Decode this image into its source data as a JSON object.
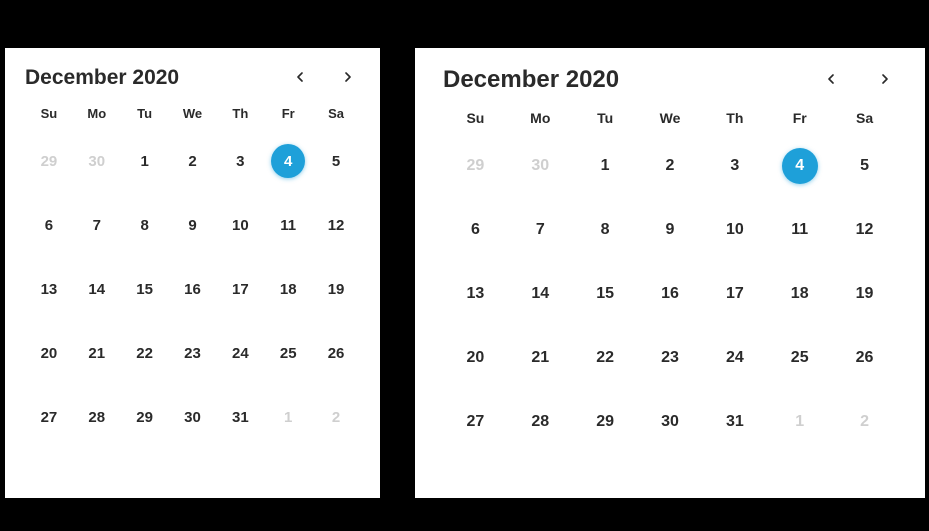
{
  "calendars": [
    {
      "size": "small",
      "title": "December 2020",
      "dow": [
        "Su",
        "Mo",
        "Tu",
        "We",
        "Th",
        "Fr",
        "Sa"
      ],
      "weeks": [
        [
          {
            "d": "29",
            "other": true
          },
          {
            "d": "30",
            "other": true
          },
          {
            "d": "1"
          },
          {
            "d": "2"
          },
          {
            "d": "3"
          },
          {
            "d": "4",
            "selected": true
          },
          {
            "d": "5"
          }
        ],
        [
          {
            "d": "6"
          },
          {
            "d": "7"
          },
          {
            "d": "8"
          },
          {
            "d": "9"
          },
          {
            "d": "10"
          },
          {
            "d": "11"
          },
          {
            "d": "12"
          }
        ],
        [
          {
            "d": "13"
          },
          {
            "d": "14"
          },
          {
            "d": "15"
          },
          {
            "d": "16"
          },
          {
            "d": "17"
          },
          {
            "d": "18"
          },
          {
            "d": "19"
          }
        ],
        [
          {
            "d": "20"
          },
          {
            "d": "21"
          },
          {
            "d": "22"
          },
          {
            "d": "23"
          },
          {
            "d": "24"
          },
          {
            "d": "25"
          },
          {
            "d": "26"
          }
        ],
        [
          {
            "d": "27"
          },
          {
            "d": "28"
          },
          {
            "d": "29"
          },
          {
            "d": "30"
          },
          {
            "d": "31"
          },
          {
            "d": "1",
            "other": true
          },
          {
            "d": "2",
            "other": true
          }
        ]
      ]
    },
    {
      "size": "large",
      "title": "December 2020",
      "dow": [
        "Su",
        "Mo",
        "Tu",
        "We",
        "Th",
        "Fr",
        "Sa"
      ],
      "weeks": [
        [
          {
            "d": "29",
            "other": true
          },
          {
            "d": "30",
            "other": true
          },
          {
            "d": "1"
          },
          {
            "d": "2"
          },
          {
            "d": "3"
          },
          {
            "d": "4",
            "selected": true
          },
          {
            "d": "5"
          }
        ],
        [
          {
            "d": "6"
          },
          {
            "d": "7"
          },
          {
            "d": "8"
          },
          {
            "d": "9"
          },
          {
            "d": "10"
          },
          {
            "d": "11"
          },
          {
            "d": "12"
          }
        ],
        [
          {
            "d": "13"
          },
          {
            "d": "14"
          },
          {
            "d": "15"
          },
          {
            "d": "16"
          },
          {
            "d": "17"
          },
          {
            "d": "18"
          },
          {
            "d": "19"
          }
        ],
        [
          {
            "d": "20"
          },
          {
            "d": "21"
          },
          {
            "d": "22"
          },
          {
            "d": "23"
          },
          {
            "d": "24"
          },
          {
            "d": "25"
          },
          {
            "d": "26"
          }
        ],
        [
          {
            "d": "27"
          },
          {
            "d": "28"
          },
          {
            "d": "29"
          },
          {
            "d": "30"
          },
          {
            "d": "31"
          },
          {
            "d": "1",
            "other": true
          },
          {
            "d": "2",
            "other": true
          }
        ]
      ]
    }
  ]
}
